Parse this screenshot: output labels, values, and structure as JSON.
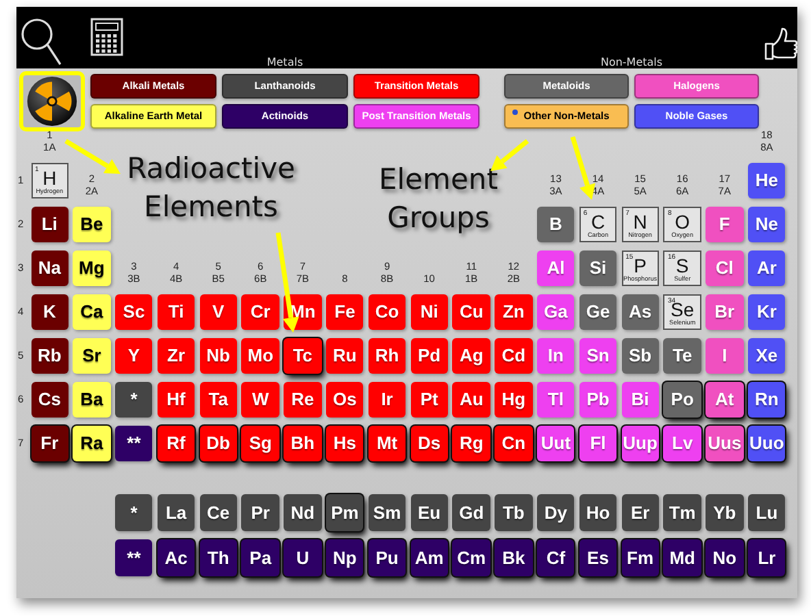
{
  "header": {
    "headings": [
      "Metals",
      "Non-Metals"
    ]
  },
  "radioactive_filter": {
    "selected": true
  },
  "legend": {
    "metals": [
      {
        "label": "Alkali Metals",
        "kind": "alkali",
        "color": "#6b0000",
        "selected": false
      },
      {
        "label": "Lanthanoids",
        "kind": "lanthanoid",
        "color": "#454545",
        "selected": false
      },
      {
        "label": "Transition Metals",
        "kind": "transition",
        "color": "#ff0000",
        "selected": false
      },
      {
        "label": "Alkaline Earth Metal",
        "kind": "alkaline",
        "color": "#ffff55",
        "selected": false
      },
      {
        "label": "Actinoids",
        "kind": "actinoid",
        "color": "#2e0066",
        "selected": false
      },
      {
        "label": "Post Transition Metals",
        "kind": "post",
        "color": "#ee40f0",
        "selected": false
      }
    ],
    "non_metals": [
      {
        "label": "Metaloids",
        "kind": "metalloid",
        "color": "#666666",
        "selected": false
      },
      {
        "label": "Halogens",
        "kind": "halogen",
        "color": "#f050c0",
        "selected": false
      },
      {
        "label": "Other Non-Metals",
        "kind": "nonmetal",
        "color": "#f9bd52",
        "selected": true
      },
      {
        "label": "Noble Gases",
        "kind": "noble",
        "color": "#5050f5",
        "selected": false
      }
    ]
  },
  "groups": [
    {
      "number": "1",
      "label": "1A"
    },
    {
      "number": "2",
      "label": "2A"
    },
    {
      "number": "3",
      "label": "3B"
    },
    {
      "number": "4",
      "label": "4B"
    },
    {
      "number": "5",
      "label": "B5"
    },
    {
      "number": "6",
      "label": "6B"
    },
    {
      "number": "7",
      "label": "7B"
    },
    {
      "number": "8"
    },
    {
      "number": "9",
      "label": "8B"
    },
    {
      "number": "10"
    },
    {
      "number": "11",
      "label": "1B"
    },
    {
      "number": "12",
      "label": "2B"
    },
    {
      "number": "13",
      "label": "3A"
    },
    {
      "number": "14",
      "label": "4A"
    },
    {
      "number": "15",
      "label": "5A"
    },
    {
      "number": "16",
      "label": "6A"
    },
    {
      "number": "17",
      "label": "7A"
    },
    {
      "number": "18",
      "label": "8A"
    }
  ],
  "periods": [
    {
      "number": "1",
      "cells": [
        {
          "symbol": "H",
          "number": "1",
          "name": "Hydrogen",
          "kind": "nonmetal",
          "radioactive": false
        },
        null,
        null,
        null,
        null,
        null,
        null,
        null,
        null,
        null,
        null,
        null,
        null,
        null,
        null,
        null,
        null,
        {
          "symbol": "He",
          "kind": "noble",
          "radioactive": false
        }
      ]
    },
    {
      "number": "2",
      "cells": [
        {
          "symbol": "Li",
          "kind": "alkali",
          "radioactive": false
        },
        {
          "symbol": "Be",
          "kind": "alkaline",
          "radioactive": false
        },
        null,
        null,
        null,
        null,
        null,
        null,
        null,
        null,
        null,
        null,
        {
          "symbol": "B",
          "kind": "metalloid",
          "radioactive": false
        },
        {
          "symbol": "C",
          "number": "6",
          "name": "Carbon",
          "kind": "nonmetal",
          "radioactive": false
        },
        {
          "symbol": "N",
          "number": "7",
          "name": "Nitrogen",
          "kind": "nonmetal",
          "radioactive": false
        },
        {
          "symbol": "O",
          "number": "8",
          "name": "Oxygen",
          "kind": "nonmetal",
          "radioactive": false
        },
        {
          "symbol": "F",
          "kind": "halogen",
          "radioactive": false
        },
        {
          "symbol": "Ne",
          "kind": "noble",
          "radioactive": false
        }
      ]
    },
    {
      "number": "3",
      "cells": [
        {
          "symbol": "Na",
          "kind": "alkali",
          "radioactive": false
        },
        {
          "symbol": "Mg",
          "kind": "alkaline",
          "radioactive": false
        },
        null,
        null,
        null,
        null,
        null,
        null,
        null,
        null,
        null,
        null,
        {
          "symbol": "Al",
          "kind": "post",
          "radioactive": false
        },
        {
          "symbol": "Si",
          "kind": "metalloid",
          "radioactive": false
        },
        {
          "symbol": "P",
          "number": "15",
          "name": "Phosphorus",
          "kind": "nonmetal",
          "radioactive": false
        },
        {
          "symbol": "S",
          "number": "16",
          "name": "Sulfer",
          "kind": "nonmetal",
          "radioactive": false
        },
        {
          "symbol": "Cl",
          "kind": "halogen",
          "radioactive": false
        },
        {
          "symbol": "Ar",
          "kind": "noble",
          "radioactive": false
        }
      ]
    },
    {
      "number": "4",
      "cells": [
        {
          "symbol": "K",
          "kind": "alkali",
          "radioactive": false
        },
        {
          "symbol": "Ca",
          "kind": "alkaline",
          "radioactive": false
        },
        {
          "symbol": "Sc",
          "kind": "transition",
          "radioactive": false
        },
        {
          "symbol": "Ti",
          "kind": "transition",
          "radioactive": false
        },
        {
          "symbol": "V",
          "kind": "transition",
          "radioactive": false
        },
        {
          "symbol": "Cr",
          "kind": "transition",
          "radioactive": false
        },
        {
          "symbol": "Mn",
          "kind": "transition",
          "radioactive": false
        },
        {
          "symbol": "Fe",
          "kind": "transition",
          "radioactive": false
        },
        {
          "symbol": "Co",
          "kind": "transition",
          "radioactive": false
        },
        {
          "symbol": "Ni",
          "kind": "transition",
          "radioactive": false
        },
        {
          "symbol": "Cu",
          "kind": "transition",
          "radioactive": false
        },
        {
          "symbol": "Zn",
          "kind": "transition",
          "radioactive": false
        },
        {
          "symbol": "Ga",
          "kind": "post",
          "radioactive": false
        },
        {
          "symbol": "Ge",
          "kind": "metalloid",
          "radioactive": false
        },
        {
          "symbol": "As",
          "kind": "metalloid",
          "radioactive": false
        },
        {
          "symbol": "Se",
          "number": "34",
          "name": "Selenium",
          "kind": "nonmetal",
          "radioactive": false
        },
        {
          "symbol": "Br",
          "kind": "halogen",
          "radioactive": false
        },
        {
          "symbol": "Kr",
          "kind": "noble",
          "radioactive": false
        }
      ]
    },
    {
      "number": "5",
      "cells": [
        {
          "symbol": "Rb",
          "kind": "alkali",
          "radioactive": false
        },
        {
          "symbol": "Sr",
          "kind": "alkaline",
          "radioactive": false
        },
        {
          "symbol": "Y",
          "kind": "transition",
          "radioactive": false
        },
        {
          "symbol": "Zr",
          "kind": "transition",
          "radioactive": false
        },
        {
          "symbol": "Nb",
          "kind": "transition",
          "radioactive": false
        },
        {
          "symbol": "Mo",
          "kind": "transition",
          "radioactive": false
        },
        {
          "symbol": "Tc",
          "kind": "transition",
          "radioactive": true
        },
        {
          "symbol": "Ru",
          "kind": "transition",
          "radioactive": false
        },
        {
          "symbol": "Rh",
          "kind": "transition",
          "radioactive": false
        },
        {
          "symbol": "Pd",
          "kind": "transition",
          "radioactive": false
        },
        {
          "symbol": "Ag",
          "kind": "transition",
          "radioactive": false
        },
        {
          "symbol": "Cd",
          "kind": "transition",
          "radioactive": false
        },
        {
          "symbol": "In",
          "kind": "post",
          "radioactive": false
        },
        {
          "symbol": "Sn",
          "kind": "post",
          "radioactive": false
        },
        {
          "symbol": "Sb",
          "kind": "metalloid",
          "radioactive": false
        },
        {
          "symbol": "Te",
          "kind": "metalloid",
          "radioactive": false
        },
        {
          "symbol": "I",
          "kind": "halogen",
          "radioactive": false
        },
        {
          "symbol": "Xe",
          "kind": "noble",
          "radioactive": false
        }
      ]
    },
    {
      "number": "6",
      "cells": [
        {
          "symbol": "Cs",
          "kind": "alkali",
          "radioactive": false
        },
        {
          "symbol": "Ba",
          "kind": "alkaline",
          "radioactive": false
        },
        {
          "symbol": "*",
          "kind": "lanthanoid",
          "radioactive": false
        },
        {
          "symbol": "Hf",
          "kind": "transition",
          "radioactive": false
        },
        {
          "symbol": "Ta",
          "kind": "transition",
          "radioactive": false
        },
        {
          "symbol": "W",
          "kind": "transition",
          "radioactive": false
        },
        {
          "symbol": "Re",
          "kind": "transition",
          "radioactive": false
        },
        {
          "symbol": "Os",
          "kind": "transition",
          "radioactive": false
        },
        {
          "symbol": "Ir",
          "kind": "transition",
          "radioactive": false
        },
        {
          "symbol": "Pt",
          "kind": "transition",
          "radioactive": false
        },
        {
          "symbol": "Au",
          "kind": "transition",
          "radioactive": false
        },
        {
          "symbol": "Hg",
          "kind": "transition",
          "radioactive": false
        },
        {
          "symbol": "Tl",
          "kind": "post",
          "radioactive": false
        },
        {
          "symbol": "Pb",
          "kind": "post",
          "radioactive": false
        },
        {
          "symbol": "Bi",
          "kind": "post",
          "radioactive": false
        },
        {
          "symbol": "Po",
          "kind": "metalloid",
          "radioactive": true
        },
        {
          "symbol": "At",
          "kind": "halogen",
          "radioactive": true
        },
        {
          "symbol": "Rn",
          "kind": "noble",
          "radioactive": true
        }
      ]
    },
    {
      "number": "7",
      "cells": [
        {
          "symbol": "Fr",
          "kind": "alkali",
          "radioactive": true
        },
        {
          "symbol": "Ra",
          "kind": "alkaline",
          "radioactive": true
        },
        {
          "symbol": "**",
          "kind": "actinoid",
          "radioactive": false
        },
        {
          "symbol": "Rf",
          "kind": "transition",
          "radioactive": true
        },
        {
          "symbol": "Db",
          "kind": "transition",
          "radioactive": true
        },
        {
          "symbol": "Sg",
          "kind": "transition",
          "radioactive": true
        },
        {
          "symbol": "Bh",
          "kind": "transition",
          "radioactive": true
        },
        {
          "symbol": "Hs",
          "kind": "transition",
          "radioactive": true
        },
        {
          "symbol": "Mt",
          "kind": "transition",
          "radioactive": true
        },
        {
          "symbol": "Ds",
          "kind": "transition",
          "radioactive": true
        },
        {
          "symbol": "Rg",
          "kind": "transition",
          "radioactive": true
        },
        {
          "symbol": "Cn",
          "kind": "transition",
          "radioactive": true
        },
        {
          "symbol": "Uut",
          "kind": "post",
          "radioactive": true
        },
        {
          "symbol": "Fl",
          "kind": "post",
          "radioactive": true
        },
        {
          "symbol": "Uup",
          "kind": "post",
          "radioactive": true
        },
        {
          "symbol": "Lv",
          "kind": "post",
          "radioactive": true
        },
        {
          "symbol": "Uus",
          "kind": "halogen",
          "radioactive": true
        },
        {
          "symbol": "Uuo",
          "kind": "noble",
          "radioactive": true
        }
      ]
    }
  ],
  "series": [
    {
      "cells": [
        {
          "symbol": "*",
          "kind": "lanthanoid",
          "radioactive": false
        },
        {
          "symbol": "La",
          "kind": "lanthanoid",
          "radioactive": false
        },
        {
          "symbol": "Ce",
          "kind": "lanthanoid",
          "radioactive": false
        },
        {
          "symbol": "Pr",
          "kind": "lanthanoid",
          "radioactive": false
        },
        {
          "symbol": "Nd",
          "kind": "lanthanoid",
          "radioactive": false
        },
        {
          "symbol": "Pm",
          "kind": "lanthanoid",
          "radioactive": true
        },
        {
          "symbol": "Sm",
          "kind": "lanthanoid",
          "radioactive": false
        },
        {
          "symbol": "Eu",
          "kind": "lanthanoid",
          "radioactive": false
        },
        {
          "symbol": "Gd",
          "kind": "lanthanoid",
          "radioactive": false
        },
        {
          "symbol": "Tb",
          "kind": "lanthanoid",
          "radioactive": false
        },
        {
          "symbol": "Dy",
          "kind": "lanthanoid",
          "radioactive": false
        },
        {
          "symbol": "Ho",
          "kind": "lanthanoid",
          "radioactive": false
        },
        {
          "symbol": "Er",
          "kind": "lanthanoid",
          "radioactive": false
        },
        {
          "symbol": "Tm",
          "kind": "lanthanoid",
          "radioactive": false
        },
        {
          "symbol": "Yb",
          "kind": "lanthanoid",
          "radioactive": false
        },
        {
          "symbol": "Lu",
          "kind": "lanthanoid",
          "radioactive": false
        }
      ]
    },
    {
      "cells": [
        {
          "symbol": "**",
          "kind": "actinoid",
          "radioactive": false
        },
        {
          "symbol": "Ac",
          "kind": "actinoid",
          "radioactive": true
        },
        {
          "symbol": "Th",
          "kind": "actinoid",
          "radioactive": true
        },
        {
          "symbol": "Pa",
          "kind": "actinoid",
          "radioactive": true
        },
        {
          "symbol": "U",
          "kind": "actinoid",
          "radioactive": true
        },
        {
          "symbol": "Np",
          "kind": "actinoid",
          "radioactive": true
        },
        {
          "symbol": "Pu",
          "kind": "actinoid",
          "radioactive": true
        },
        {
          "symbol": "Am",
          "kind": "actinoid",
          "radioactive": true
        },
        {
          "symbol": "Cm",
          "kind": "actinoid",
          "radioactive": true
        },
        {
          "symbol": "Bk",
          "kind": "actinoid",
          "radioactive": true
        },
        {
          "symbol": "Cf",
          "kind": "actinoid",
          "radioactive": true
        },
        {
          "symbol": "Es",
          "kind": "actinoid",
          "radioactive": true
        },
        {
          "symbol": "Fm",
          "kind": "actinoid",
          "radioactive": true
        },
        {
          "symbol": "Md",
          "kind": "actinoid",
          "radioactive": true
        },
        {
          "symbol": "No",
          "kind": "actinoid",
          "radioactive": true
        },
        {
          "symbol": "Lr",
          "kind": "actinoid",
          "radioactive": true
        }
      ]
    }
  ],
  "annotations": [
    {
      "text": "Radioactive Elements"
    },
    {
      "text": "Element Groups"
    }
  ]
}
